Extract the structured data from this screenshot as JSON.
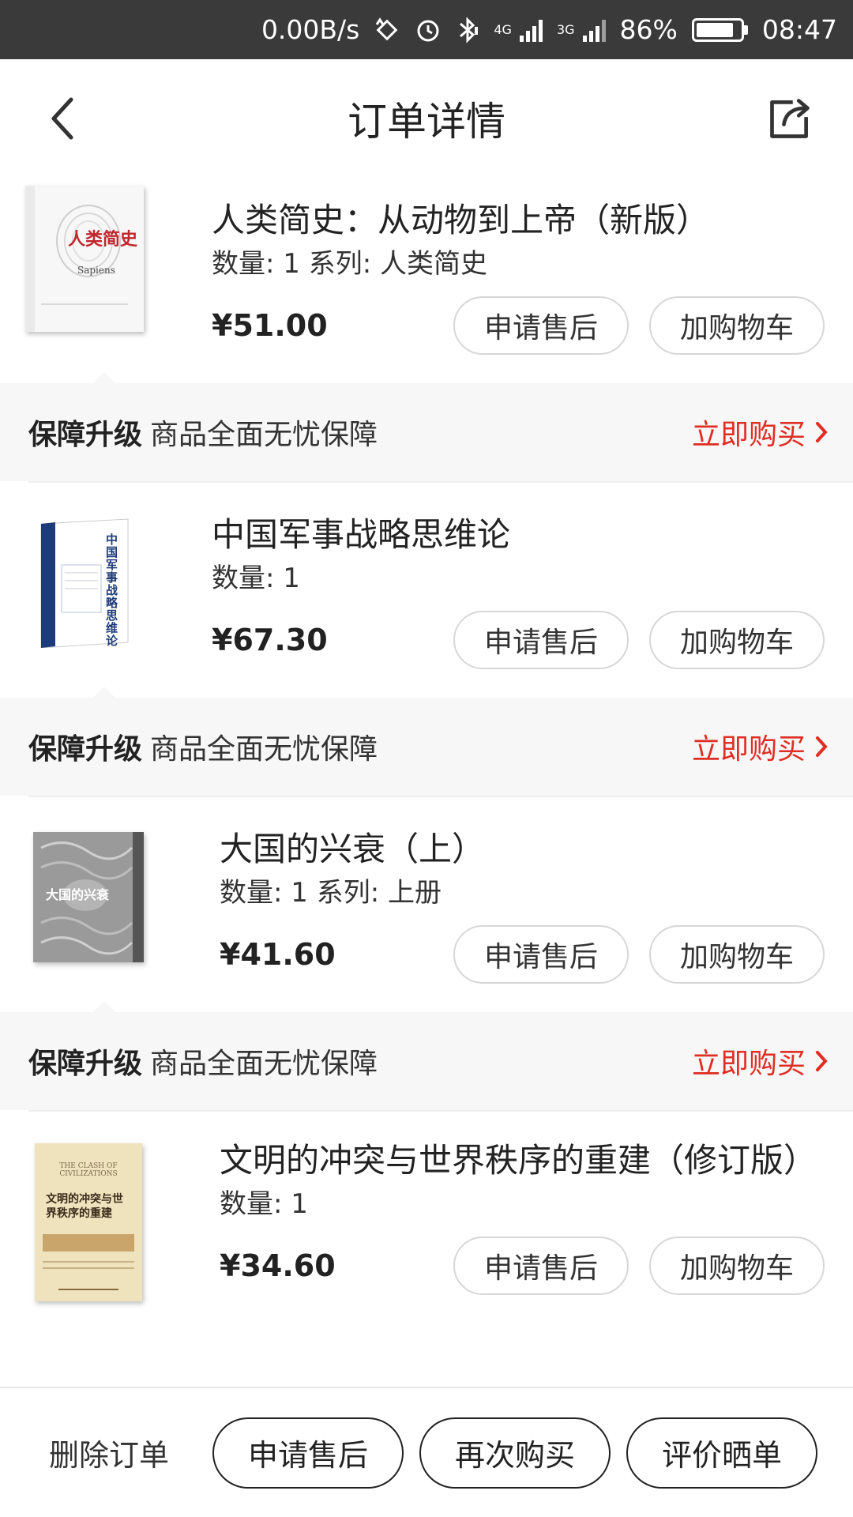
{
  "status_bar": {
    "net_speed": "0.00B/s",
    "network_1": "4G",
    "network_2": "3G",
    "battery": "86%",
    "battery_level": 0.86,
    "time": "08:47"
  },
  "header": {
    "title": "订单详情"
  },
  "products": [
    {
      "title": "人类简史：从动物到上帝（新版）",
      "meta": "数量: 1 系列: 人类简史",
      "price": "¥51.00",
      "cover_title": "人类简史",
      "cover_subtitle": "Sapiens"
    },
    {
      "title": "中国军事战略思维论",
      "meta": "数量: 1",
      "price": "¥67.30",
      "cover_title": "中国军事战略思维论"
    },
    {
      "title": "大国的兴衰（上）",
      "meta": "数量: 1 系列: 上册",
      "price": "¥41.60",
      "cover_title": "大国的兴衰"
    },
    {
      "title": "文明的冲突与世界秩序的重建（修订版）",
      "meta": "数量: 1",
      "price": "¥34.60",
      "cover_title": "文明的冲突与世界秩序的重建",
      "cover_subtitle": "THE CLASH OF CIVILIZATIONS"
    }
  ],
  "product_actions": {
    "after_sale": "申请售后",
    "add_to_cart": "加购物车"
  },
  "guarantee": {
    "label": "保障升级",
    "text": "商品全面无忧保障",
    "action": "立即购买"
  },
  "bottom_bar": {
    "delete": "删除订单",
    "after_sale": "申请售后",
    "buy_again": "再次购买",
    "review": "评价晒单"
  },
  "colors": {
    "accent": "#e02e24",
    "status_bar_bg": "#3a3a3a",
    "guarantee_bg": "#f7f7f7"
  }
}
